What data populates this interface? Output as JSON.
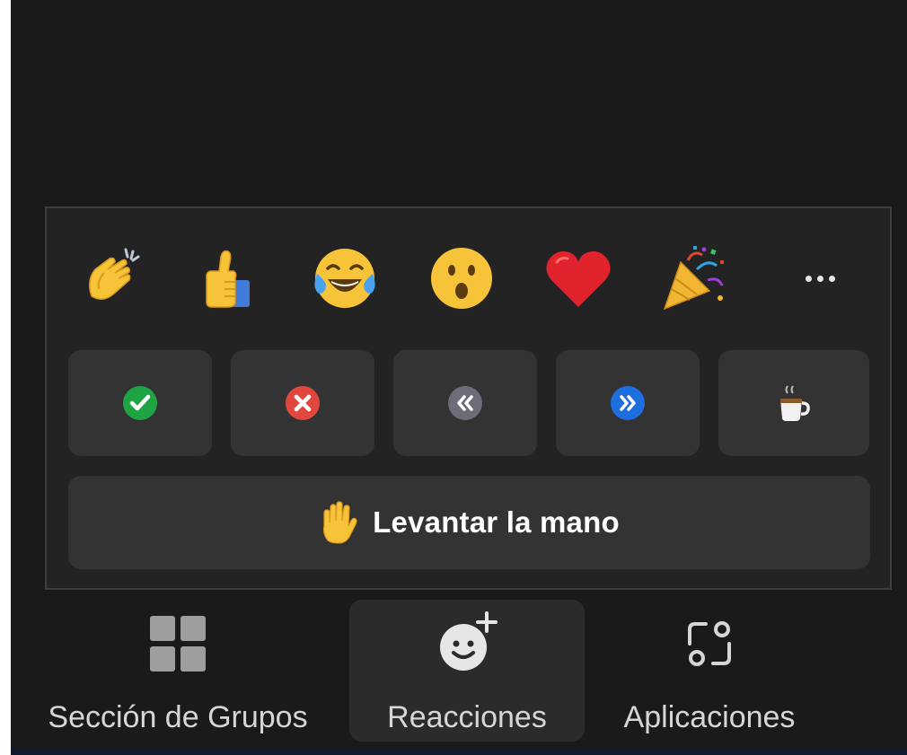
{
  "reactions_panel": {
    "emojis": [
      {
        "name": "clapping-hands",
        "glyph": "👏"
      },
      {
        "name": "thumbs-up",
        "glyph": "👍"
      },
      {
        "name": "tears-of-joy",
        "glyph": "😂"
      },
      {
        "name": "open-mouth",
        "glyph": "😮"
      },
      {
        "name": "red-heart",
        "glyph": "❤"
      },
      {
        "name": "party-popper",
        "glyph": "🎉"
      }
    ],
    "more_icon": "ellipsis-icon",
    "status_buttons": [
      {
        "name": "yes",
        "icon": "check-circle-icon",
        "color": "#1fa443"
      },
      {
        "name": "no",
        "icon": "x-circle-icon",
        "color": "#e0483e"
      },
      {
        "name": "slow-down",
        "icon": "rewind-circle-icon",
        "color": "#6d6d7a"
      },
      {
        "name": "speed-up",
        "icon": "fast-forward-circle-icon",
        "color": "#1f6ee0"
      },
      {
        "name": "coffee",
        "icon": "coffee-cup-icon",
        "color": "#ffffff"
      }
    ],
    "raise_hand": {
      "icon": "raised-hand-icon",
      "label": "Levantar la mano"
    }
  },
  "toolbar": {
    "items": [
      {
        "label": "Sección de Grupos",
        "icon": "breakout-grid-icon"
      },
      {
        "label": "Reacciones",
        "icon": "smiley-plus-icon",
        "active": true
      },
      {
        "label": "Aplicaciones",
        "icon": "apps-icon"
      }
    ]
  },
  "colors": {
    "background": "#1a1a1a",
    "panel": "#232323",
    "button": "#333333",
    "text": "#ffffff"
  }
}
